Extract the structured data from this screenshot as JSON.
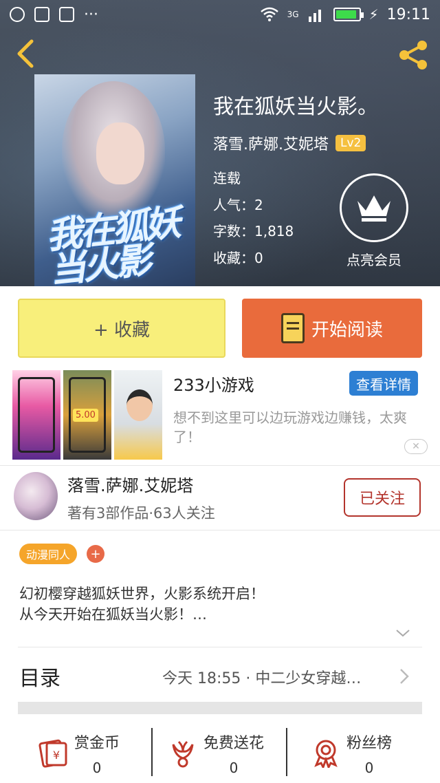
{
  "status_bar": {
    "time": "19:11",
    "network": "3G"
  },
  "book": {
    "title": "我在狐妖当火影。",
    "author": "落雪.萨娜.艾妮塔",
    "level": "Lv2",
    "status": "连载",
    "popularity": "人气：2",
    "word_count": "字数：1,818",
    "favorites": "收藏：0",
    "cover_text": "我在狐妖当火影"
  },
  "vip": {
    "label": "点亮会员"
  },
  "actions": {
    "favorite_label": "+ 收藏",
    "read_label": "开始阅读"
  },
  "ad": {
    "title": "233小游戏",
    "detail_label": "查看详情",
    "description": "想不到这里可以边玩游戏边赚钱，太爽了！",
    "thumb_price": "5.00",
    "close_label": "✕"
  },
  "author_card": {
    "name": "落雪.萨娜.艾妮塔",
    "subtitle": "著有3部作品·63人关注",
    "follow_label": "已关注"
  },
  "tags": [
    {
      "label": "动漫同人"
    }
  ],
  "tag_add_label": "+",
  "description": {
    "line1": "幻初樱穿越狐妖世界，火影系统开启！",
    "line2": "从今天开始在狐妖当火影！…"
  },
  "toc": {
    "label": "目录",
    "latest": "今天 18:55 · 中二少女穿越…"
  },
  "bottom_bar": [
    {
      "icon": "red-envelope-icon",
      "label": "赏金币",
      "count": "0"
    },
    {
      "icon": "flower-icon",
      "label": "免费送花",
      "count": "0"
    },
    {
      "icon": "medal-icon",
      "label": "粉丝榜",
      "count": "0"
    }
  ],
  "colors": {
    "accent_orange": "#e96b3c",
    "favorite_yellow": "#f8ef7b",
    "follow_red": "#b3342c",
    "ad_blue": "#2d7fd3",
    "tag_orange": "#f5a52a"
  }
}
